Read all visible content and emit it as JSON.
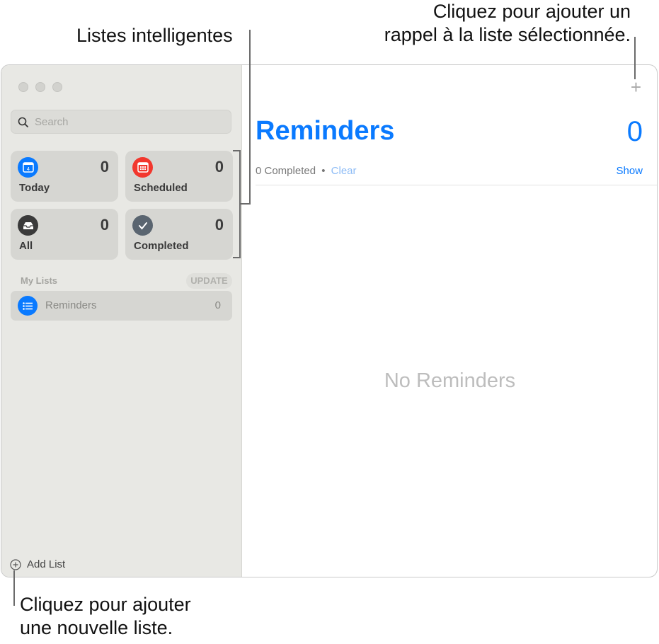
{
  "callouts": {
    "smart_lists": "Listes intelligentes",
    "add_reminder": [
      "Cliquez pour ajouter un",
      "rappel à la liste sélectionnée."
    ],
    "add_list": [
      "Cliquez pour ajouter",
      "une nouvelle liste."
    ]
  },
  "sidebar": {
    "search_placeholder": "Search",
    "smart_lists": [
      {
        "label": "Today",
        "count": "0",
        "color": "#0a7aff",
        "icon": "calendar-today-icon"
      },
      {
        "label": "Scheduled",
        "count": "0",
        "color": "#f2372d",
        "icon": "calendar-icon"
      },
      {
        "label": "All",
        "count": "0",
        "color": "#3a3a3a",
        "icon": "tray-icon"
      },
      {
        "label": "Completed",
        "count": "0",
        "color": "#5a6570",
        "icon": "checkmark-icon"
      }
    ],
    "today_day": "4",
    "my_lists_header": "My Lists",
    "update_label": "UPDATE",
    "lists": [
      {
        "label": "Reminders",
        "count": "0",
        "color": "#0a7aff",
        "icon": "list-icon"
      }
    ],
    "add_list_label": "Add List"
  },
  "main": {
    "title": "Reminders",
    "count": "0",
    "completed_text": "0 Completed",
    "separator": "•",
    "clear_label": "Clear",
    "show_label": "Show",
    "empty_text": "No Reminders",
    "add_icon": "plus-icon"
  }
}
